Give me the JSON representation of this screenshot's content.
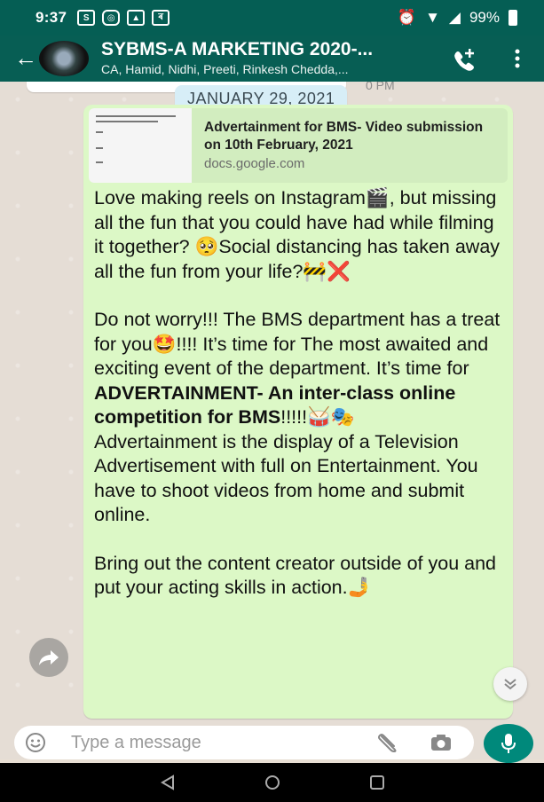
{
  "status_bar": {
    "time": "9:37",
    "battery": "99%",
    "left_icons": [
      "s-icon",
      "instagram-icon",
      "gallery-icon",
      "bh-icon"
    ],
    "right_icons": [
      "alarm-icon",
      "wifi-icon",
      "signal-icon",
      "battery-icon"
    ]
  },
  "header": {
    "title": "SYBMS-A MARKETING 2020-...",
    "subtitle": "CA, Hamid, Nidhi, Preeti, Rinkesh Chedda,...",
    "accent": "#075e54"
  },
  "chat": {
    "prev_time": "0 PM",
    "date_label": "JANUARY 29, 2021",
    "link_preview": {
      "title": "Advertainment for BMS- Video submission on 10th February, 2021",
      "domain": "docs.google.com"
    },
    "message": {
      "p1": "Love making reels on Instagram🎬, but missing all the fun that you could have had while filming it together? 🥺Social distancing has taken away all the fun from your life?🚧❌",
      "p2_lead": "Do not worry!!! The BMS department has a treat for you🤩!!!! It’s time for The most awaited and exciting event of the department. It’s time for ",
      "p2_bold": "ADVERTAINMENT- An inter-class online competition for BMS",
      "p2_tail": "!!!!!🥁🎭",
      "p3": "Advertainment is the display of a Television Advertisement with full on Entertainment. You have to shoot videos from home and submit online.",
      "p4": "Bring out the content creator outside of you and put your acting skills in action.🤳"
    },
    "bubble_color": "#dcf8c6"
  },
  "input": {
    "placeholder": "Type a message"
  }
}
